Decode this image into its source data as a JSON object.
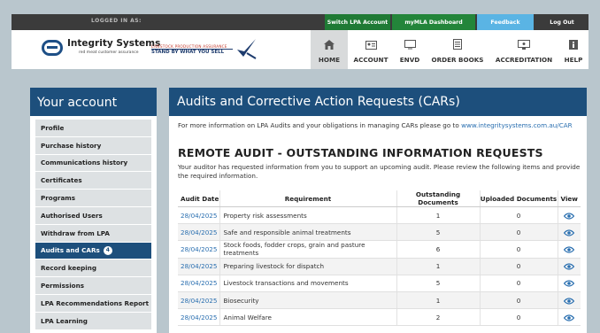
{
  "topbar": {
    "logged_in": "LOGGED IN AS:",
    "switch_account": "Switch LPA Account",
    "mymla": "myMLA Dashboard",
    "feedback": "Feedback",
    "logout": "Log Out"
  },
  "brand": {
    "name": "Integrity Systems",
    "tagline": "red meat customer assurance",
    "lpa_small": "LIVESTOCK PRODUCTION ASSURANCE",
    "lpa_main": "STAND BY WHAT YOU SELL"
  },
  "nav": [
    {
      "label": "HOME",
      "icon": "home-icon"
    },
    {
      "label": "ACCOUNT",
      "icon": "id-card-icon"
    },
    {
      "label": "ENVD",
      "icon": "monitor-icon"
    },
    {
      "label": "ORDER BOOKS",
      "icon": "document-icon"
    },
    {
      "label": "ACCREDITATION",
      "icon": "certificate-icon"
    },
    {
      "label": "HELP",
      "icon": "info-icon"
    }
  ],
  "sidebar": {
    "title": "Your account",
    "items": [
      {
        "label": "Profile"
      },
      {
        "label": "Purchase history"
      },
      {
        "label": "Communications history"
      },
      {
        "label": "Certificates"
      },
      {
        "label": "Programs"
      },
      {
        "label": "Authorised Users"
      },
      {
        "label": "Withdraw from LPA"
      },
      {
        "label": "Audits and CARs",
        "badge": "4"
      },
      {
        "label": "Record keeping"
      },
      {
        "label": "Permissions"
      },
      {
        "label": "LPA Recommendations Report"
      },
      {
        "label": "LPA Learning"
      }
    ]
  },
  "main": {
    "title": "Audits and Corrective Action Requests (CARs)",
    "intro_text": "For more information on LPA Audits and your obligations in managing CARs please go to ",
    "intro_link": "www.integritysystems.com.au/CAR",
    "section_title": "REMOTE AUDIT - OUTSTANDING INFORMATION REQUESTS",
    "description": "Your auditor has requested information from you to support an upcoming audit. Please review the following items and provide the required information.",
    "columns": [
      "Audit Date",
      "Requirement",
      "Outstanding Documents",
      "Uploaded Documents",
      "View"
    ],
    "rows": [
      {
        "date": "28/04/2025",
        "requirement": "Property risk assessments",
        "outstanding": "1",
        "uploaded": "0"
      },
      {
        "date": "28/04/2025",
        "requirement": "Safe and responsible animal treatments",
        "outstanding": "5",
        "uploaded": "0"
      },
      {
        "date": "28/04/2025",
        "requirement": "Stock foods, fodder crops, grain and pasture treatments",
        "outstanding": "6",
        "uploaded": "0"
      },
      {
        "date": "28/04/2025",
        "requirement": "Preparing livestock for dispatch",
        "outstanding": "1",
        "uploaded": "0"
      },
      {
        "date": "28/04/2025",
        "requirement": "Livestock transactions and movements",
        "outstanding": "5",
        "uploaded": "0"
      },
      {
        "date": "28/04/2025",
        "requirement": "Biosecurity",
        "outstanding": "1",
        "uploaded": "0"
      },
      {
        "date": "28/04/2025",
        "requirement": "Animal Welfare",
        "outstanding": "2",
        "uploaded": "0"
      }
    ]
  },
  "colors": {
    "primary": "#1d4f7c",
    "link": "#2a6fb0",
    "switch_green": "#1f7a35",
    "feedback_blue": "#5ab4e4"
  }
}
